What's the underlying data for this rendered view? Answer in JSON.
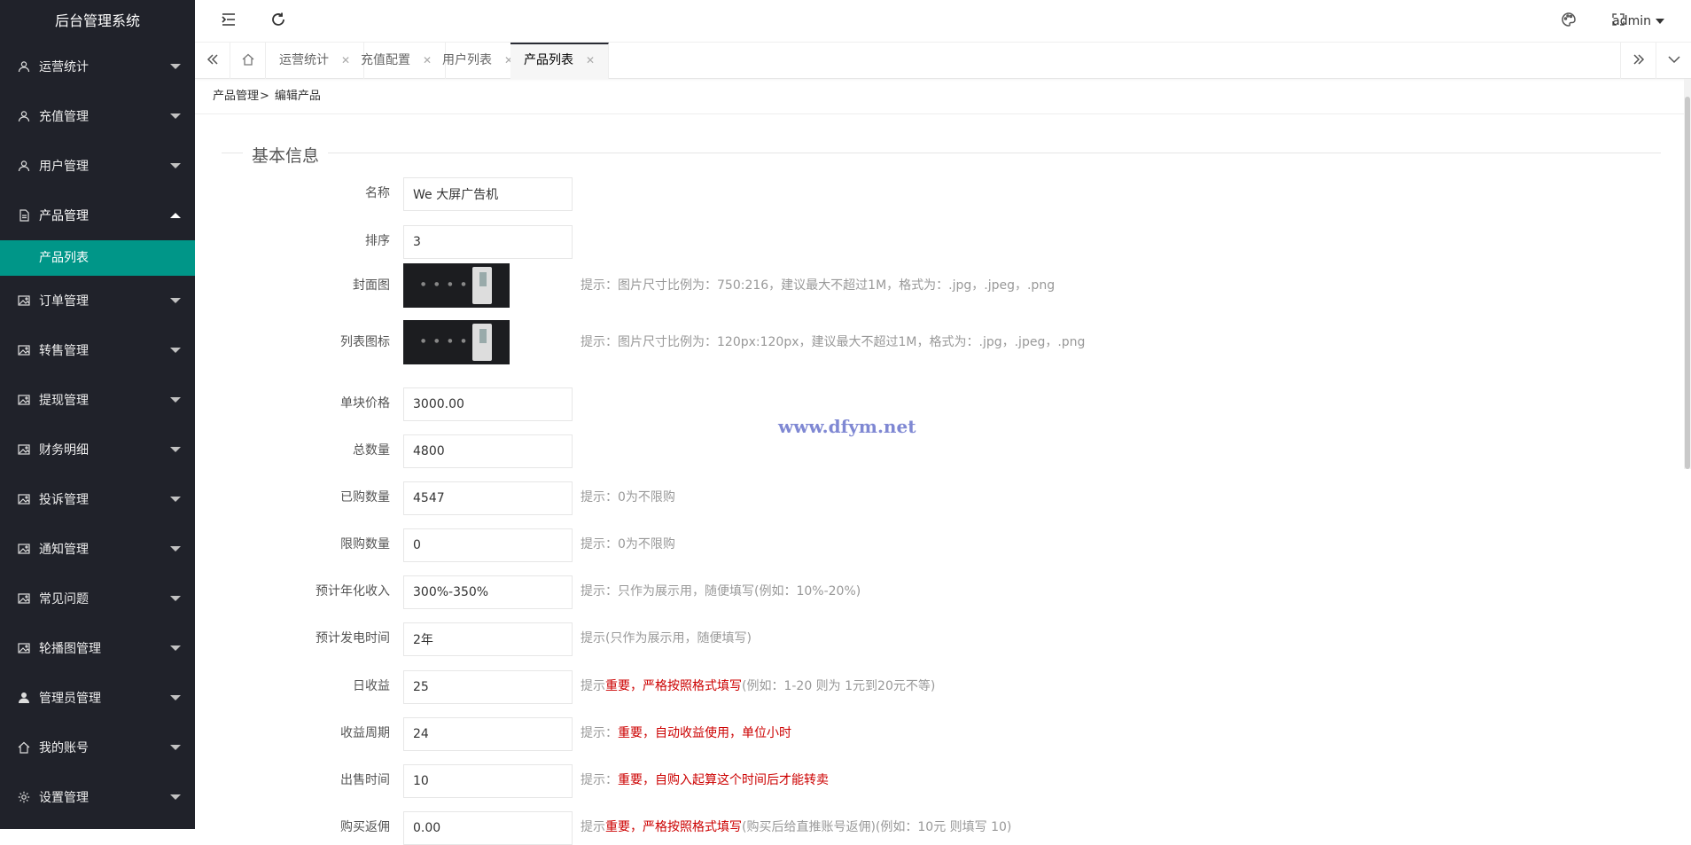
{
  "app": {
    "title": "后台管理系统"
  },
  "sidebar": {
    "items": [
      {
        "label": "运营统计",
        "icon": "user-icon"
      },
      {
        "label": "充值管理",
        "icon": "user-icon"
      },
      {
        "label": "用户管理",
        "icon": "user-icon"
      },
      {
        "label": "产品管理",
        "icon": "file-icon",
        "expanded": true
      },
      {
        "label": "订单管理",
        "icon": "image-icon"
      },
      {
        "label": "转售管理",
        "icon": "image-icon"
      },
      {
        "label": "提现管理",
        "icon": "image-icon"
      },
      {
        "label": "财务明细",
        "icon": "image-icon"
      },
      {
        "label": "投诉管理",
        "icon": "image-icon"
      },
      {
        "label": "通知管理",
        "icon": "image-icon"
      },
      {
        "label": "常见问题",
        "icon": "image-icon"
      },
      {
        "label": "轮播图管理",
        "icon": "image-icon"
      },
      {
        "label": "管理员管理",
        "icon": "person-icon"
      },
      {
        "label": "我的账号",
        "icon": "home-icon"
      },
      {
        "label": "设置管理",
        "icon": "gear-icon"
      }
    ],
    "sub_item": "产品列表",
    "active_color": "#009688"
  },
  "header": {
    "user": "admin"
  },
  "tabs": [
    {
      "label": "运营统计"
    },
    {
      "label": "充值配置"
    },
    {
      "label": "用户列表"
    },
    {
      "label": "产品列表",
      "active": true
    }
  ],
  "breadcrumb": {
    "parent": "产品管理",
    "separator": ">",
    "current": "编辑产品"
  },
  "form": {
    "section_title": "基本信息",
    "fields": [
      {
        "label": "名称",
        "value": "We 大屏广告机"
      },
      {
        "label": "排序",
        "value": "3"
      },
      {
        "label": "封面图",
        "hint": "提示：图片尺寸比例为：750:216，建议最大不超过1M，格式为：.jpg，.jpeg，.png"
      },
      {
        "label": "列表图标",
        "hint": "提示：图片尺寸比例为：120px:120px，建议最大不超过1M，格式为：.jpg，.jpeg，.png"
      },
      {
        "label": "单块价格",
        "value": "3000.00"
      },
      {
        "label": "总数量",
        "value": "4800"
      },
      {
        "label": "已购数量",
        "value": "4547",
        "hint": "提示：0为不限购"
      },
      {
        "label": "限购数量",
        "value": "0",
        "hint": "提示：0为不限购"
      },
      {
        "label": "预计年化收入",
        "value": "300%-350%",
        "hint": "提示：只作为展示用，随便填写(例如：10%-20%)"
      },
      {
        "label": "预计发电时间",
        "value": "2年",
        "hint": "提示(只作为展示用，随便填写)"
      },
      {
        "label": "日收益",
        "value": "25",
        "hint_prefix": "提示",
        "hint_red": "重要，严格按照格式填写",
        "hint_suffix": "(例如：1-20 则为 1元到20元不等)"
      },
      {
        "label": "收益周期",
        "value": "24",
        "hint_prefix": "提示：",
        "hint_red": "重要，自动收益使用，单位小时",
        "hint_suffix": ""
      },
      {
        "label": "出售时间",
        "value": "10",
        "hint_prefix": "提示：",
        "hint_red": "重要，自购入起算这个时间后才能转卖",
        "hint_suffix": ""
      },
      {
        "label": "购买返佣",
        "value": "0.00",
        "hint_prefix": "提示",
        "hint_red": "重要，严格按照格式填写",
        "hint_suffix": "(购买后给直推账号返佣)(例如：10元 则填写 10)"
      }
    ]
  },
  "watermark": "www.dfym.net"
}
